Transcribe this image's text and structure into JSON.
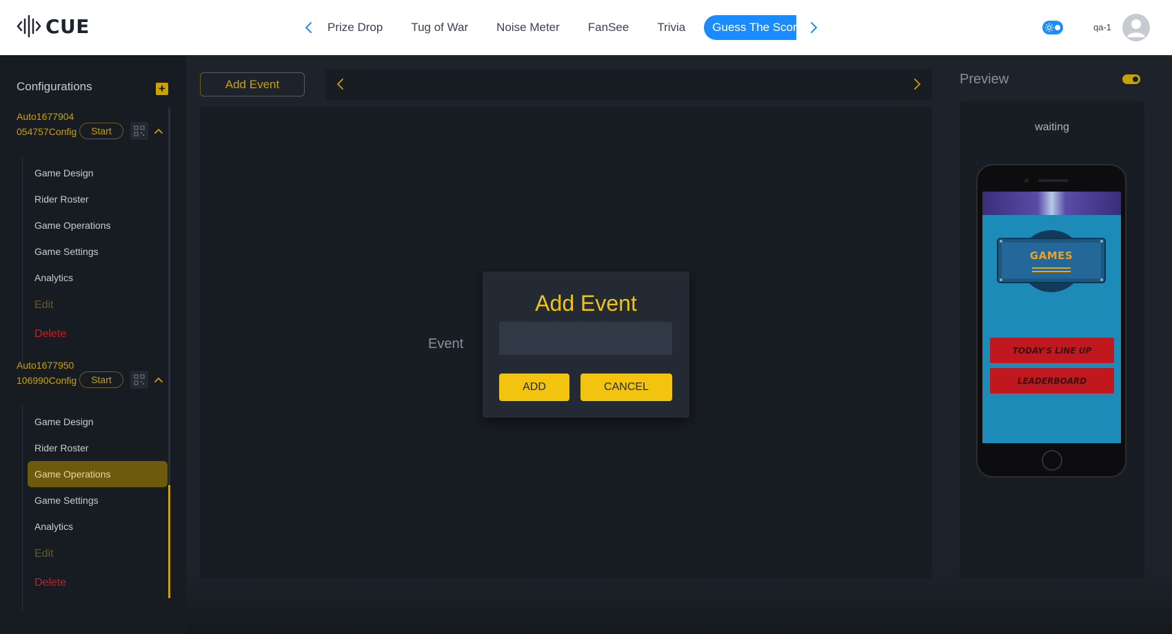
{
  "app": {
    "logo_text": "CUE"
  },
  "header": {
    "tabs": [
      {
        "label": "Prize Drop"
      },
      {
        "label": "Tug of War"
      },
      {
        "label": "Noise Meter"
      },
      {
        "label": "FanSee"
      },
      {
        "label": "Trivia"
      },
      {
        "label": "Guess The Score",
        "active": true
      }
    ],
    "user_label": "qa-1"
  },
  "sidebar": {
    "title": "Configurations",
    "configs": [
      {
        "name": "Auto1677904054757Config",
        "start_label": "Start",
        "items": [
          "Game Design",
          "Rider Roster",
          "Game Operations",
          "Game Settings",
          "Analytics"
        ],
        "edit_label": "Edit",
        "delete_label": "Delete"
      },
      {
        "name": "Auto1677950106990Config",
        "start_label": "Start",
        "items": [
          "Game Design",
          "Rider Roster",
          "Game Operations",
          "Game Settings",
          "Analytics"
        ],
        "active_item": "Game Operations",
        "edit_label": "Edit",
        "delete_label": "Delete"
      }
    ]
  },
  "main": {
    "add_event_label": "Add Event",
    "placeholder": "Event"
  },
  "preview": {
    "title": "Preview",
    "status": "waiting",
    "phone": {
      "logo_text": "GAMES",
      "buttons": [
        "TODAY'S LINE UP",
        "LEADERBOARD"
      ]
    }
  },
  "modal": {
    "title": "Add Event",
    "input_value": "",
    "add_label": "ADD",
    "cancel_label": "CANCEL"
  },
  "colors": {
    "accent": "#f2c40f",
    "brand_blue": "#1a8cff",
    "delete_red": "#c21f2a"
  }
}
